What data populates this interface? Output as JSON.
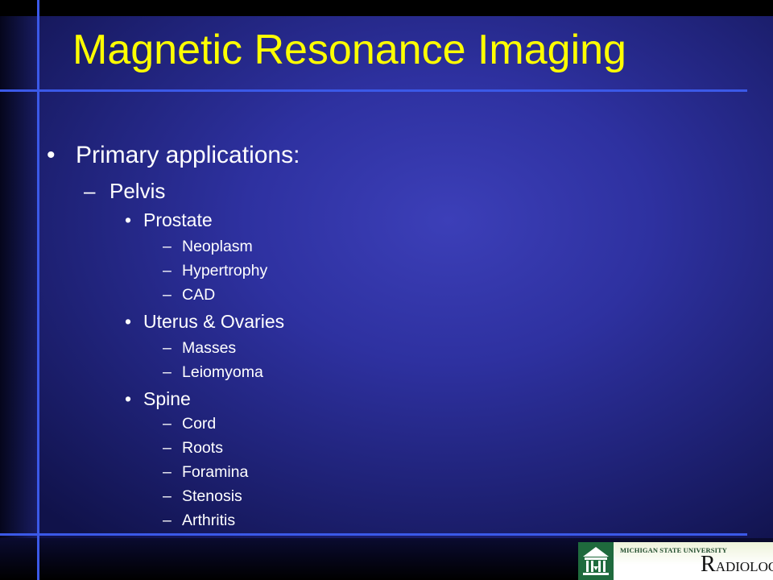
{
  "slide": {
    "title": "Magnetic Resonance Imaging",
    "bullets": [
      {
        "level": 1,
        "marker": "•",
        "text": "Primary applications:"
      },
      {
        "level": 2,
        "marker": "–",
        "text": "Pelvis"
      },
      {
        "level": 3,
        "marker": "•",
        "text": "Prostate"
      },
      {
        "level": 4,
        "marker": "–",
        "text": "Neoplasm"
      },
      {
        "level": 4,
        "marker": "–",
        "text": "Hypertrophy"
      },
      {
        "level": 4,
        "marker": "–",
        "text": "CAD"
      },
      {
        "level": 3,
        "marker": "•",
        "text": "Uterus & Ovaries"
      },
      {
        "level": 4,
        "marker": "–",
        "text": "Masses"
      },
      {
        "level": 4,
        "marker": "–",
        "text": "Leiomyoma"
      },
      {
        "level": 3,
        "marker": "•",
        "text": "Spine"
      },
      {
        "level": 4,
        "marker": "–",
        "text": "Cord"
      },
      {
        "level": 4,
        "marker": "–",
        "text": "Roots"
      },
      {
        "level": 4,
        "marker": "–",
        "text": "Foramina"
      },
      {
        "level": 4,
        "marker": "–",
        "text": "Stenosis"
      },
      {
        "level": 4,
        "marker": "–",
        "text": "Arthritis"
      }
    ]
  },
  "logo": {
    "university": "MICHIGAN STATE UNIVERSITY",
    "department_initial": "R",
    "department_rest": "ADIOLOGY",
    "icon": "msu-building-icon"
  },
  "colors": {
    "title": "#ffff00",
    "text": "#ffffff",
    "accent_lines": "#3b59e8",
    "logo_green": "#1f6a3d"
  }
}
